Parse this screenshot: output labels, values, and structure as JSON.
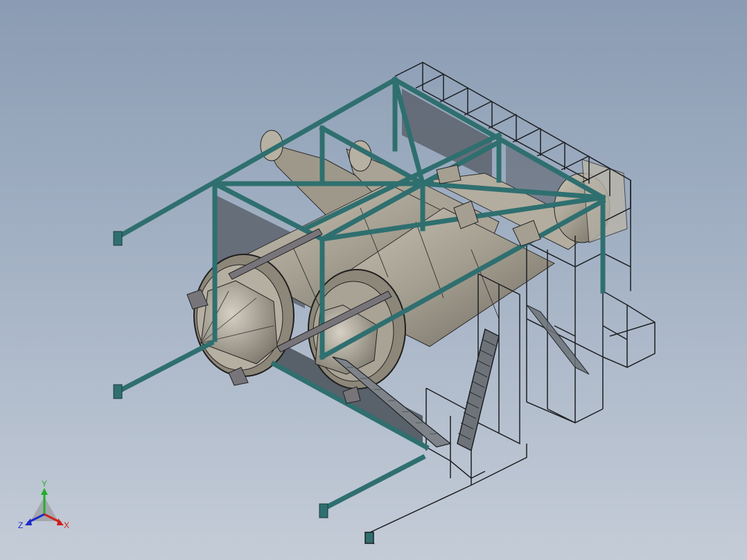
{
  "colors": {
    "background_top": "#8a9cb3",
    "background_bottom": "#c4ccd7",
    "steel_frame": "#2f6f6f",
    "steel_dark": "#1f4f50",
    "wireframe": "#1c1f22",
    "vessel_body": "#a9a395",
    "vessel_shade": "#6f6b61",
    "panel": "#555c66",
    "axis_x": "#d0201a",
    "axis_y": "#21b02a",
    "axis_z": "#1f2cc8"
  },
  "triad": {
    "x_label": "X",
    "y_label": "Y",
    "z_label": "Z"
  },
  "model": {
    "description_icon": "3d-assembly-model"
  }
}
